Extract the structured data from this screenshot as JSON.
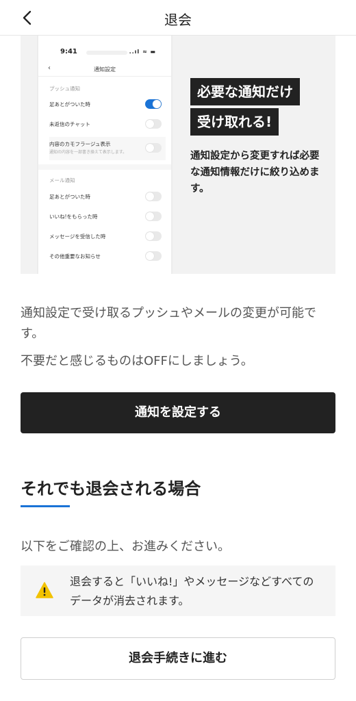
{
  "header": {
    "back_icon": "chevron-left-icon",
    "title": "退会"
  },
  "promo": {
    "phone": {
      "time": "9:41",
      "status_icons": "..ıl ≈ ▬",
      "screen_title": "通知設定",
      "push_section": "プッシュ通知",
      "push_items": [
        {
          "label": "足あとがついた時",
          "on": true
        },
        {
          "label": "未返信のチャット",
          "on": false
        },
        {
          "label": "内容のカモフラージュ表示",
          "sub": "通知の内容を一部書き換えて表示します。",
          "on": false
        }
      ],
      "mail_section": "メール通知",
      "mail_items": [
        {
          "label": "足あとがついた時",
          "on": false
        },
        {
          "label": "いいね!をもらった時",
          "on": false
        },
        {
          "label": "メッセージを受信した時",
          "on": false
        },
        {
          "label": "その他重要なお知らせ",
          "on": false
        }
      ]
    },
    "headline_1": "必要な通知だけ",
    "headline_2": "受け取れる!",
    "description": "通知設定から変更すれば必要な通知情報だけに絞り込めます。"
  },
  "main": {
    "info_text_1": "通知設定で受け取るプッシュやメールの変更が可能です。",
    "info_text_2": "不要だと感じるものはOFFにしましょう。",
    "notification_button": "通知を設定する",
    "withdraw_heading": "それでも退会される場合",
    "confirm_text": "以下をご確認の上、お進みください。",
    "warning_icon": "warning-icon",
    "warning_text": "退会すると「いいね!」やメッセージなどすべてのデータが消去されます。",
    "proceed_button": "退会手続きに進む"
  },
  "colors": {
    "accent": "#1a73d6",
    "primary_button": "#222222",
    "warning": "#f2c200"
  }
}
